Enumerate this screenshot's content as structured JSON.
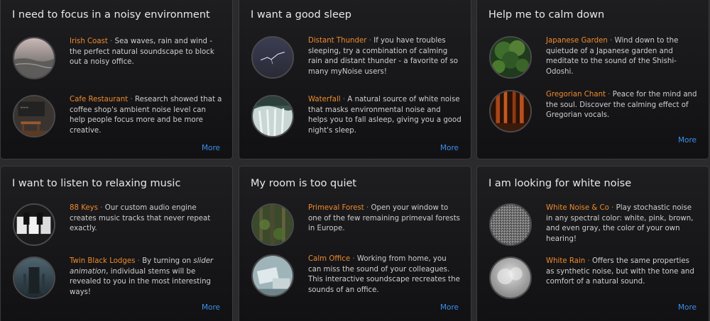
{
  "cards": [
    {
      "title": "I need to focus in a noisy environment",
      "items": [
        {
          "name": "Irish Coast",
          "text": "Sea waves, rain and wind - the perfect natural soundscape to block out a noisy office.",
          "icon": "sea-coast-thumbnail"
        },
        {
          "name": "Cafe Restaurant",
          "text": "Research showed that a coffee shop's ambient noise level can help people focus more and be more creative.",
          "icon": "cafe-thumbnail"
        }
      ],
      "more": "More"
    },
    {
      "title": "I want a good sleep",
      "items": [
        {
          "name": "Distant Thunder",
          "text": "If you have troubles sleeping, try a combination of calming rain and distant thunder - a favorite of so many myNoise users!",
          "icon": "thunder-thumbnail"
        },
        {
          "name": "Waterfall",
          "text": "A natural source of white noise that masks environmental noise and helps you to fall asleep, giving you a good night's sleep.",
          "icon": "waterfall-thumbnail"
        }
      ],
      "more": "More"
    },
    {
      "title": "Help me to calm down",
      "items": [
        {
          "name": "Japanese Garden",
          "text": "Wind down to the quietude of a Japanese garden and meditate to the sound of the Shishi-Odoshi.",
          "icon": "garden-thumbnail"
        },
        {
          "name": "Gregorian Chant",
          "text": "Peace for the mind and the soul. Discover the calming effect of Gregorian vocals.",
          "icon": "chant-thumbnail"
        }
      ],
      "more": "More"
    },
    {
      "title": "I want to listen to relaxing music",
      "items": [
        {
          "name": "88 Keys",
          "text": "Our custom audio engine creates music tracks that never repeat exactly.",
          "icon": "piano-keys-thumbnail"
        },
        {
          "name": "Twin Black Lodges",
          "text_before": "By turning on ",
          "text_em": "slider animation",
          "text": ", individual stems will be revealed to you in the most interesting ways!",
          "icon": "lodges-thumbnail"
        }
      ],
      "more": "More"
    },
    {
      "title": "My room is too quiet",
      "items": [
        {
          "name": "Primeval Forest",
          "text": "Open your window to one of the few remaining primeval forests in Europe.",
          "icon": "forest-thumbnail"
        },
        {
          "name": "Calm Office",
          "text": "Working from home, you can miss the sound of your colleagues. This interactive soundscape recreates the sounds of an office.",
          "icon": "office-thumbnail"
        }
      ],
      "more": "More"
    },
    {
      "title": "I am looking for white noise",
      "items": [
        {
          "name": "White Noise & Co",
          "text": "Play stochastic noise in any spectral color: white, pink, brown, and even gray, the color of your own hearing!",
          "icon": "static-noise-thumbnail"
        },
        {
          "name": "White Rain",
          "text": "Offers the same properties as synthetic noise, but with the tone and comfort of a natural sound.",
          "icon": "rain-thumbnail"
        }
      ],
      "more": "More"
    }
  ],
  "separator": "·"
}
